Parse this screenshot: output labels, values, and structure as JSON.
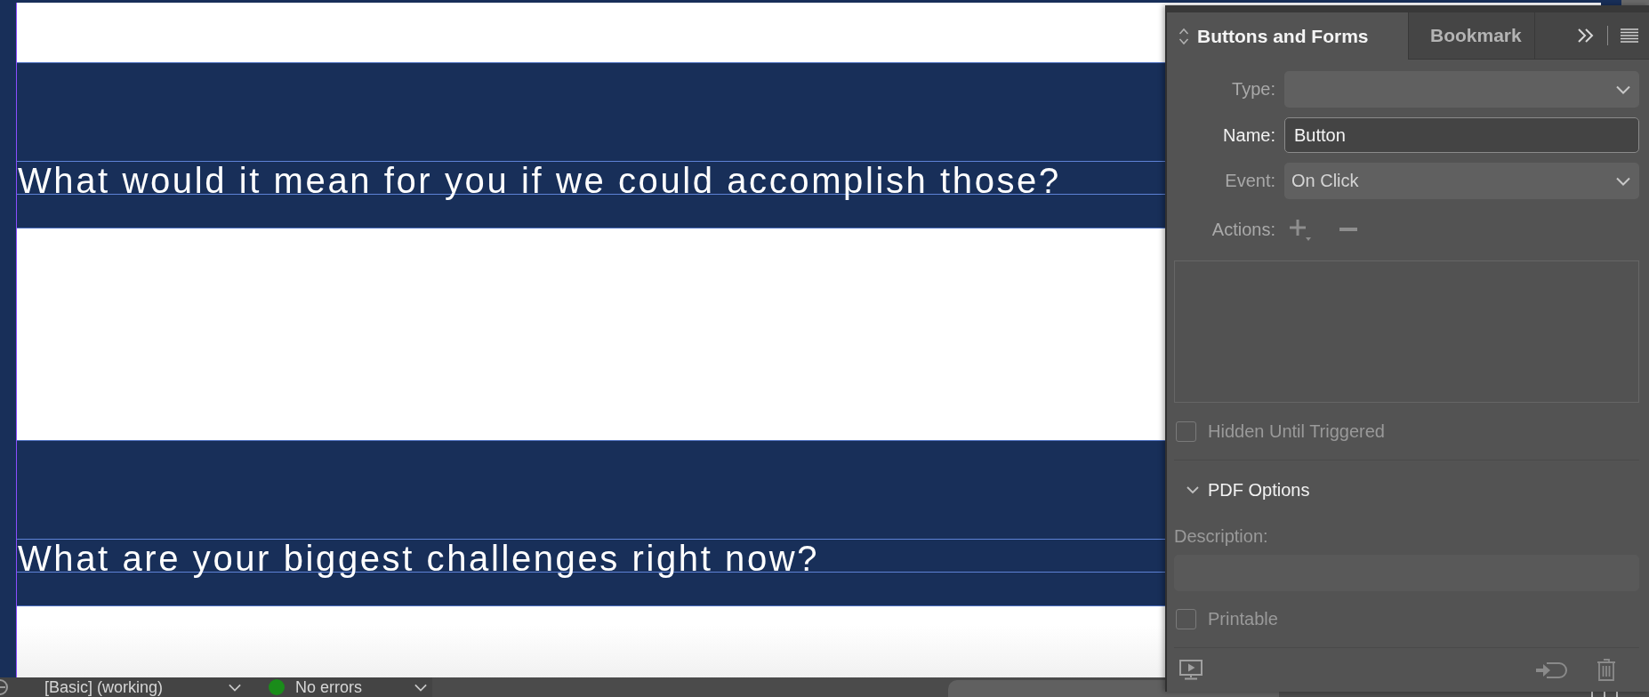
{
  "document": {
    "sections": [
      {
        "heading": "What would it mean for you if we could accomplish those?"
      },
      {
        "heading": "What are your biggest challenges right now?"
      }
    ]
  },
  "panel": {
    "tabs": [
      {
        "label": "Buttons and Forms",
        "selected": true
      },
      {
        "label": "Bookmark",
        "selected": false
      }
    ],
    "fields": [
      {
        "kind": "select",
        "label": "Type:"
      },
      {
        "kind": "text",
        "label": "Name:",
        "value": "Button"
      },
      {
        "kind": "select",
        "label": "Event:",
        "value": "On Click"
      }
    ],
    "actions": {
      "label": "Actions:"
    },
    "hidden_until_triggered": {
      "label": "Hidden Until Triggered",
      "checked": false
    },
    "pdf_options": {
      "title": "PDF Options",
      "expanded": true,
      "description": {
        "label": "Description:"
      },
      "printable": {
        "label": "Printable",
        "checked": false
      }
    }
  },
  "status_bar": {
    "profile": "[Basic] (working)",
    "errors": {
      "text": "No errors",
      "color": "#1a8c1a"
    }
  }
}
